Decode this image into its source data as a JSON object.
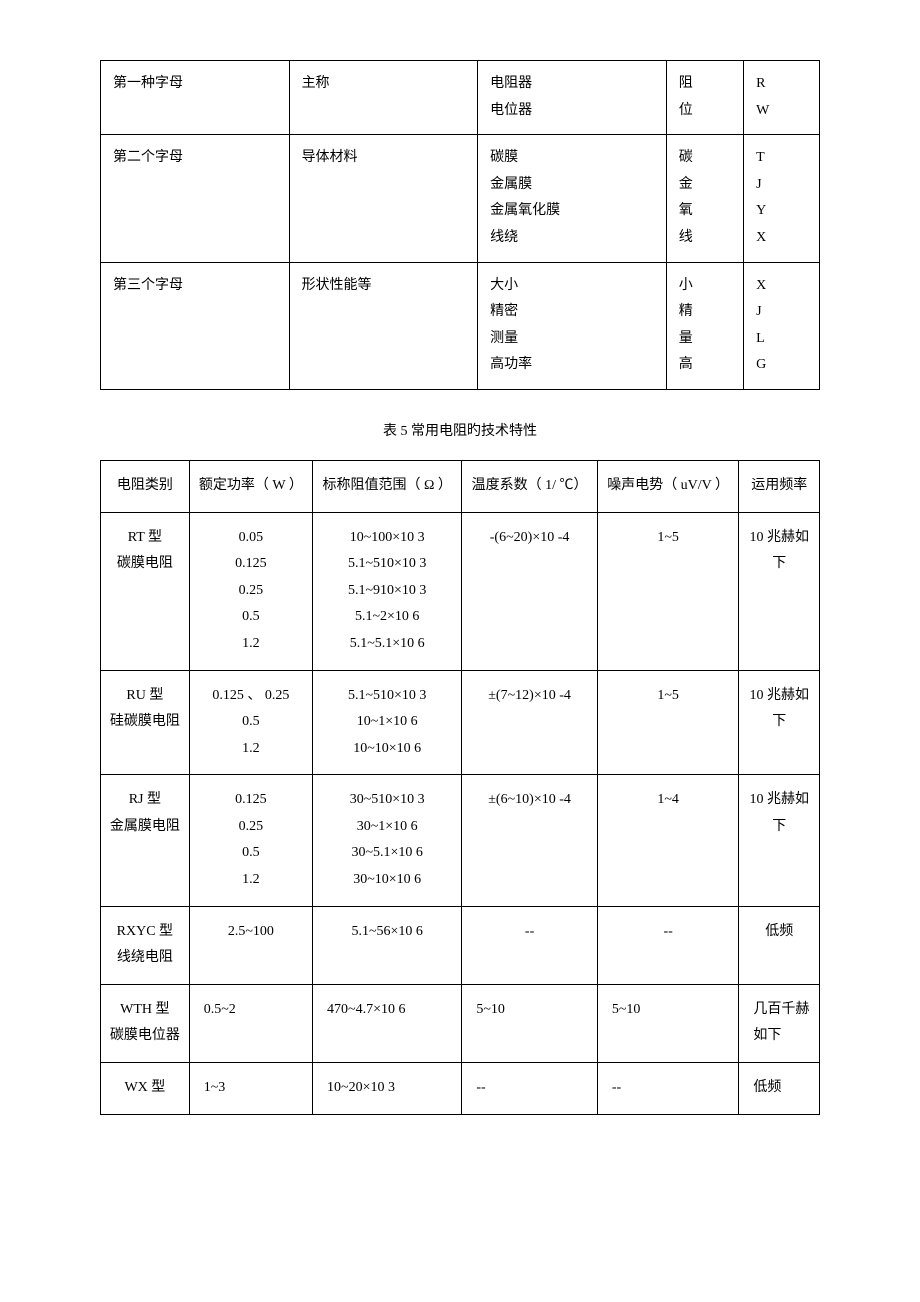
{
  "table1": {
    "rows": [
      {
        "c1": "第一种字母",
        "c2": "主称",
        "c3": [
          "电阻器",
          "电位器"
        ],
        "c4": [
          "阻",
          "位"
        ],
        "c5": [
          "R",
          "W"
        ]
      },
      {
        "c1": "第二个字母",
        "c2": "导体材料",
        "c3": [
          "碳膜",
          "金属膜",
          "金属氧化膜",
          "线绕"
        ],
        "c4": [
          "碳",
          "金",
          "氧",
          "线"
        ],
        "c5": [
          "T",
          "J",
          "Y",
          "X"
        ]
      },
      {
        "c1": "第三个字母",
        "c2": "形状性能等",
        "c3": [
          "大小",
          "精密",
          "测量",
          "高功率"
        ],
        "c4": [
          "小",
          "精",
          "量",
          "高"
        ],
        "c5": [
          "X",
          "J",
          "L",
          "G"
        ]
      }
    ]
  },
  "caption": "表 5 常用电阻旳技术特性",
  "table2": {
    "headers": {
      "h1": "电阻类别",
      "h2": "额定功率\n（ W ）",
      "h3": "标称阻值范围\n（ Ω ）",
      "h4": "温度系数\n（ 1/ ℃）",
      "h5": "噪声电势\n（ uV/V ）",
      "h6": "运用频率"
    },
    "rows": [
      {
        "c1": [
          "RT 型",
          "碳膜电阻"
        ],
        "c2": [
          "0.05",
          "0.125",
          "0.25",
          "0.5",
          "1.2"
        ],
        "c3": [
          "10~100×10 3",
          "5.1~510×10 3",
          "5.1~910×10 3",
          "5.1~2×10 6",
          "5.1~5.1×10 6"
        ],
        "c4": "-(6~20)×10 -4",
        "c5": "1~5",
        "c6": [
          "10 兆赫如",
          "下"
        ]
      },
      {
        "c1": [
          "RU 型",
          "硅碳膜电阻"
        ],
        "c2": [
          "0.125 、 0.25",
          "0.5",
          "1.2"
        ],
        "c3": [
          "5.1~510×10 3",
          "10~1×10 6",
          "10~10×10 6"
        ],
        "c4": "±(7~12)×10 -4",
        "c5": "1~5",
        "c6": [
          "10 兆赫如",
          "下"
        ]
      },
      {
        "c1": [
          "RJ 型",
          "金属膜电阻"
        ],
        "c2": [
          "0.125",
          "0.25",
          "0.5",
          "1.2"
        ],
        "c3": [
          "30~510×10 3",
          "30~1×10 6",
          "30~5.1×10 6",
          "30~10×10 6"
        ],
        "c4": "±(6~10)×10 -4",
        "c5": "1~4",
        "c6": [
          "10 兆赫如",
          "下"
        ]
      },
      {
        "c1": [
          "RXYC 型",
          "线绕电阻"
        ],
        "c2": [
          "2.5~100"
        ],
        "c3": [
          "5.1~56×10 6"
        ],
        "c4": "--",
        "c5": "--",
        "c6": [
          "低频"
        ]
      },
      {
        "c1": [
          "WTH 型",
          "碳膜电位器"
        ],
        "c2": [
          "0.5~2"
        ],
        "c3": [
          "470~4.7×10 6"
        ],
        "c4": "5~10",
        "c5": "5~10",
        "c6": [
          "几百千赫",
          "如下"
        ],
        "leftAlign": true
      },
      {
        "c1": [
          "WX 型"
        ],
        "c2": [
          "1~3"
        ],
        "c3": [
          "10~20×10 3"
        ],
        "c4": "--",
        "c5": "--",
        "c6": [
          "低频"
        ],
        "leftAlign": true
      }
    ]
  }
}
